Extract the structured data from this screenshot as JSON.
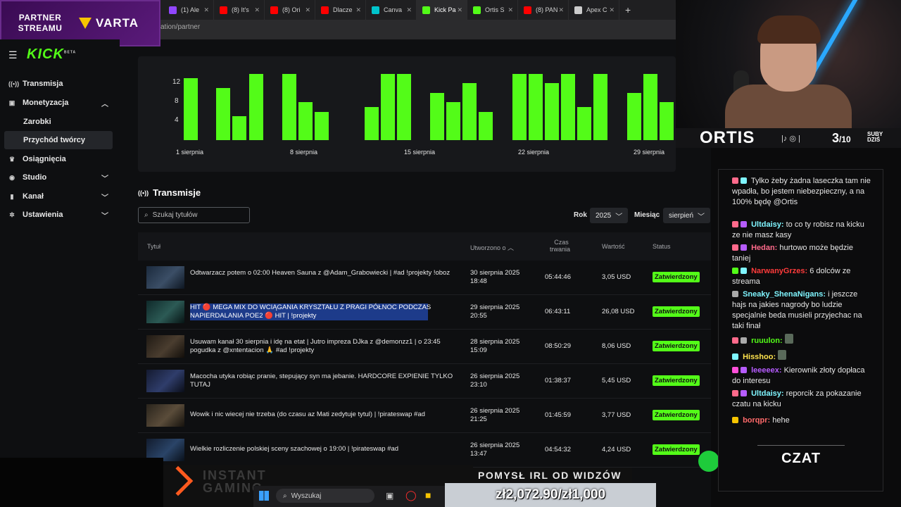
{
  "partner": {
    "line1": "PARTNER",
    "line2": "STREAMU",
    "brand": "VARTA"
  },
  "browser": {
    "tabs": [
      {
        "label": "(1) Ale",
        "color": "#9146ff"
      },
      {
        "label": "(8) It's",
        "color": "#ff0000"
      },
      {
        "label": "(8) Ori",
        "color": "#ff0000"
      },
      {
        "label": "Dlacze",
        "color": "#ff0000"
      },
      {
        "label": "Canva",
        "color": "#00c4cc"
      },
      {
        "label": "Kick Pa",
        "color": "#53fc18"
      },
      {
        "label": "Ortis S",
        "color": "#53fc18"
      },
      {
        "label": "(8) PAN",
        "color": "#ff0000"
      },
      {
        "label": "Apex C",
        "color": "#cccccc"
      }
    ],
    "url": "ation/partner"
  },
  "kick": {
    "logo": "KICK",
    "beta": "BETA",
    "nav": {
      "transmisja": "Transmisja",
      "monetyzacja": "Monetyzacja",
      "zarobki": "Zarobki",
      "przychod": "Przychód twórcy",
      "osiagniecia": "Osiągnięcia",
      "studio": "Studio",
      "kanal": "Kanał",
      "ustawienia": "Ustawienia"
    },
    "chart": {
      "yticks": [
        "12",
        "8",
        "4"
      ],
      "xlabels": [
        "1 sierpnia",
        "8 sierpnia",
        "15 sierpnia",
        "22 sierpnia",
        "29 sierpnia"
      ]
    },
    "section_title": "Transmisje",
    "search_placeholder": "Szukaj tytułów",
    "filters": {
      "rok_label": "Rok",
      "rok_value": "2025",
      "miesiac_label": "Miesiąc",
      "miesiac_value": "sierpień"
    },
    "table": {
      "headers": {
        "title": "Tytuł",
        "created": "Utworzono o",
        "duration_1": "Czas",
        "duration_2": "trwania",
        "value": "Wartość",
        "status": "Status"
      },
      "rows": [
        {
          "title": "Odtwarzacz potem o 02:00 Heaven Sauna z @Adam_Grabowiecki | #ad !projekty !oboz",
          "date": "30 sierpnia 2025",
          "time": "18:48",
          "duration": "05:44:46",
          "value": "3,05 USD",
          "status": "Zatwierdzony"
        },
        {
          "title": "HIT 🔴 MEGA MIX DO WCIĄGANIA KRYSZTAŁU Z PRAGI PÓŁNOC PODCZAS NAPIERDALANIA POE2 🔴 HIT | !projekty",
          "date": "29 sierpnia 2025",
          "time": "20:55",
          "duration": "06:43:11",
          "value": "26,08 USD",
          "status": "Zatwierdzony"
        },
        {
          "title": "Usuwam kanał 30 sierpnia i idę na etat | Jutro impreza DJka z @demonzz1 | o 23:45 pogudka z @xntentacion 🙏 #ad !projekty",
          "date": "28 sierpnia 2025",
          "time": "15:09",
          "duration": "08:50:29",
          "value": "8,06 USD",
          "status": "Zatwierdzony"
        },
        {
          "title": "Macocha utyka robiąc pranie, stepujący syn ma jebanie. HARDCORE EXPIENIE TYLKO TUTAJ",
          "date": "26 sierpnia 2025",
          "time": "23:10",
          "duration": "01:38:37",
          "value": "5,45 USD",
          "status": "Zatwierdzony"
        },
        {
          "title": "Wowik i nic wiecej nie trzeba (do czasu az Mati zedytuje tytul) | !pirateswap #ad",
          "date": "26 sierpnia 2025",
          "time": "21:25",
          "duration": "01:45:59",
          "value": "3,77 USD",
          "status": "Zatwierdzony"
        },
        {
          "title": "Wielkie rozliczenie polskiej sceny szachowej o 19:00 | !pirateswap #ad",
          "date": "26 sierpnia 2025",
          "time": "13:47",
          "duration": "04:54:32",
          "value": "4,24 USD",
          "status": "Zatwierdzony"
        }
      ]
    }
  },
  "chart_data": {
    "type": "bar",
    "series": [
      {
        "values": [
          13,
          11,
          5,
          14,
          14,
          8,
          6,
          7,
          14,
          14,
          10,
          8,
          12,
          6,
          14,
          14,
          12,
          14,
          7,
          14,
          10,
          14,
          8,
          2
        ]
      }
    ],
    "xlabels": [
      "1 sierpnia",
      "8 sierpnia",
      "15 sierpnia",
      "22 sierpnia",
      "29 sierpnia"
    ],
    "yticks": [
      4,
      8,
      12
    ],
    "ylim": [
      0,
      14
    ],
    "color": "#53fc18"
  },
  "stream": {
    "name": "ORTIS",
    "subs_current": "3",
    "subs_goal": "/10",
    "subs_label_1": "SUBY",
    "subs_label_2": "DZIŚ"
  },
  "chat": {
    "messages": [
      {
        "user": "",
        "color": "#ffffff",
        "text": "Tylko żeby żadna laseczka tam nie wpadła, bo jestem niebezpieczny, a na 100% będę @Ortis"
      },
      {
        "user": "Ultdaisy:",
        "color": "#7ff5ff",
        "text": "to co ty robisz na kicku ze nie masz kasy"
      },
      {
        "user": "Hedan:",
        "color": "#ff6a8b",
        "text": "hurtowo może będzie taniej"
      },
      {
        "user": "NarwanyGrzes:",
        "color": "#ff3b3b",
        "text": "6 dolców ze streama"
      },
      {
        "user": "Sneaky_ShenaNigans:",
        "color": "#7ff5ff",
        "text": "i jeszcze hajs na jakies nagrody bo ludzie specjalnie beda musieli przyjechac na taki finał"
      },
      {
        "user": "ruuulon:",
        "color": "#53fc18",
        "text": ""
      },
      {
        "user": "Hisshoo:",
        "color": "#ffe34d",
        "text": ""
      },
      {
        "user": "leeeeex:",
        "color": "#b65cff",
        "text": "Kierownik złoty dopłaca do interesu"
      },
      {
        "user": "Ultdaisy:",
        "color": "#7ff5ff",
        "text": "reporcik za pokazanie czatu na kicku"
      },
      {
        "user": "borqpr:",
        "color": "#ff6a6a",
        "text": "hehe"
      }
    ],
    "footer": "CZAT"
  },
  "overlays": {
    "instant_gaming": "INSTANT GAMING",
    "idea": "POMYSŁ IRL OD WIDZÓW",
    "goal": "zł2,072.90/zł1,000",
    "taskbar_search": "Wyszukaj"
  }
}
